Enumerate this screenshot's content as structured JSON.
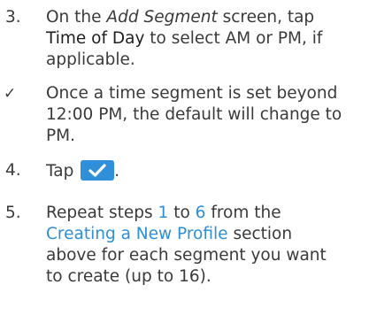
{
  "steps": {
    "s3": {
      "num": "3.",
      "t1": "On the ",
      "t2": "Add Segment",
      "t3": " screen, tap",
      "t4": "Time of Day",
      "t5": " to select AM or PM, if",
      "t6": "applicable."
    },
    "note": {
      "mark": "✓",
      "l1": "Once a time segment is set beyond",
      "l2": "12:00 PM, the default will change to",
      "l3": "PM."
    },
    "s4": {
      "num": "4.",
      "t1": "Tap ",
      "t2": ".",
      "button_icon": "checkmark-icon",
      "button_color": "#2f8fd8"
    },
    "s5": {
      "num": "5.",
      "t1": "Repeat steps ",
      "link1": "1",
      "t2": " to ",
      "link2": "6",
      "t3": " from the",
      "link3": "Creating a New Profile",
      "t4": " section",
      "l3": "above for each segment you want",
      "l4": "to create (up to 16)."
    }
  },
  "colors": {
    "text": "#3a3a3a",
    "link": "#2e8fd6",
    "accent": "#2f8fd8"
  }
}
